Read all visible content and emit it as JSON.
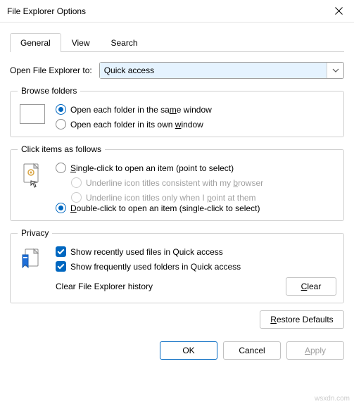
{
  "titlebar": {
    "title": "File Explorer Options"
  },
  "tabs": {
    "general": "General",
    "view": "View",
    "search": "Search"
  },
  "openTo": {
    "label": "Open File Explorer to:",
    "value": "Quick access"
  },
  "browseFolders": {
    "legend": "Browse folders",
    "same": "Open each folder in the same window",
    "sameAccess": "m",
    "own": "Open each folder in its own window",
    "ownAccess": "w"
  },
  "clickItems": {
    "legend": "Click items as follows",
    "single": "Single-click to open an item (point to select)",
    "singleAccess": "S",
    "ulBrowser": "Underline icon titles consistent with my browser",
    "ulBrowserAccess": "b",
    "ulPoint": "Underline icon titles only when I point at them",
    "ulPointAccess": "p",
    "double": "Double-click to open an item (single-click to select)",
    "doubleAccess": "D"
  },
  "privacy": {
    "legend": "Privacy",
    "recentFiles": "Show recently used files in Quick access",
    "freqFolders": "Show frequently used folders in Quick access",
    "clearLabel": "Clear File Explorer history",
    "clearBtn": "Clear",
    "clearAccess": "C"
  },
  "restore": "Restore Defaults",
  "restoreAccess": "R",
  "buttons": {
    "ok": "OK",
    "cancel": "Cancel",
    "apply": "Apply",
    "applyAccess": "A"
  },
  "watermark": "wsxdn.com"
}
